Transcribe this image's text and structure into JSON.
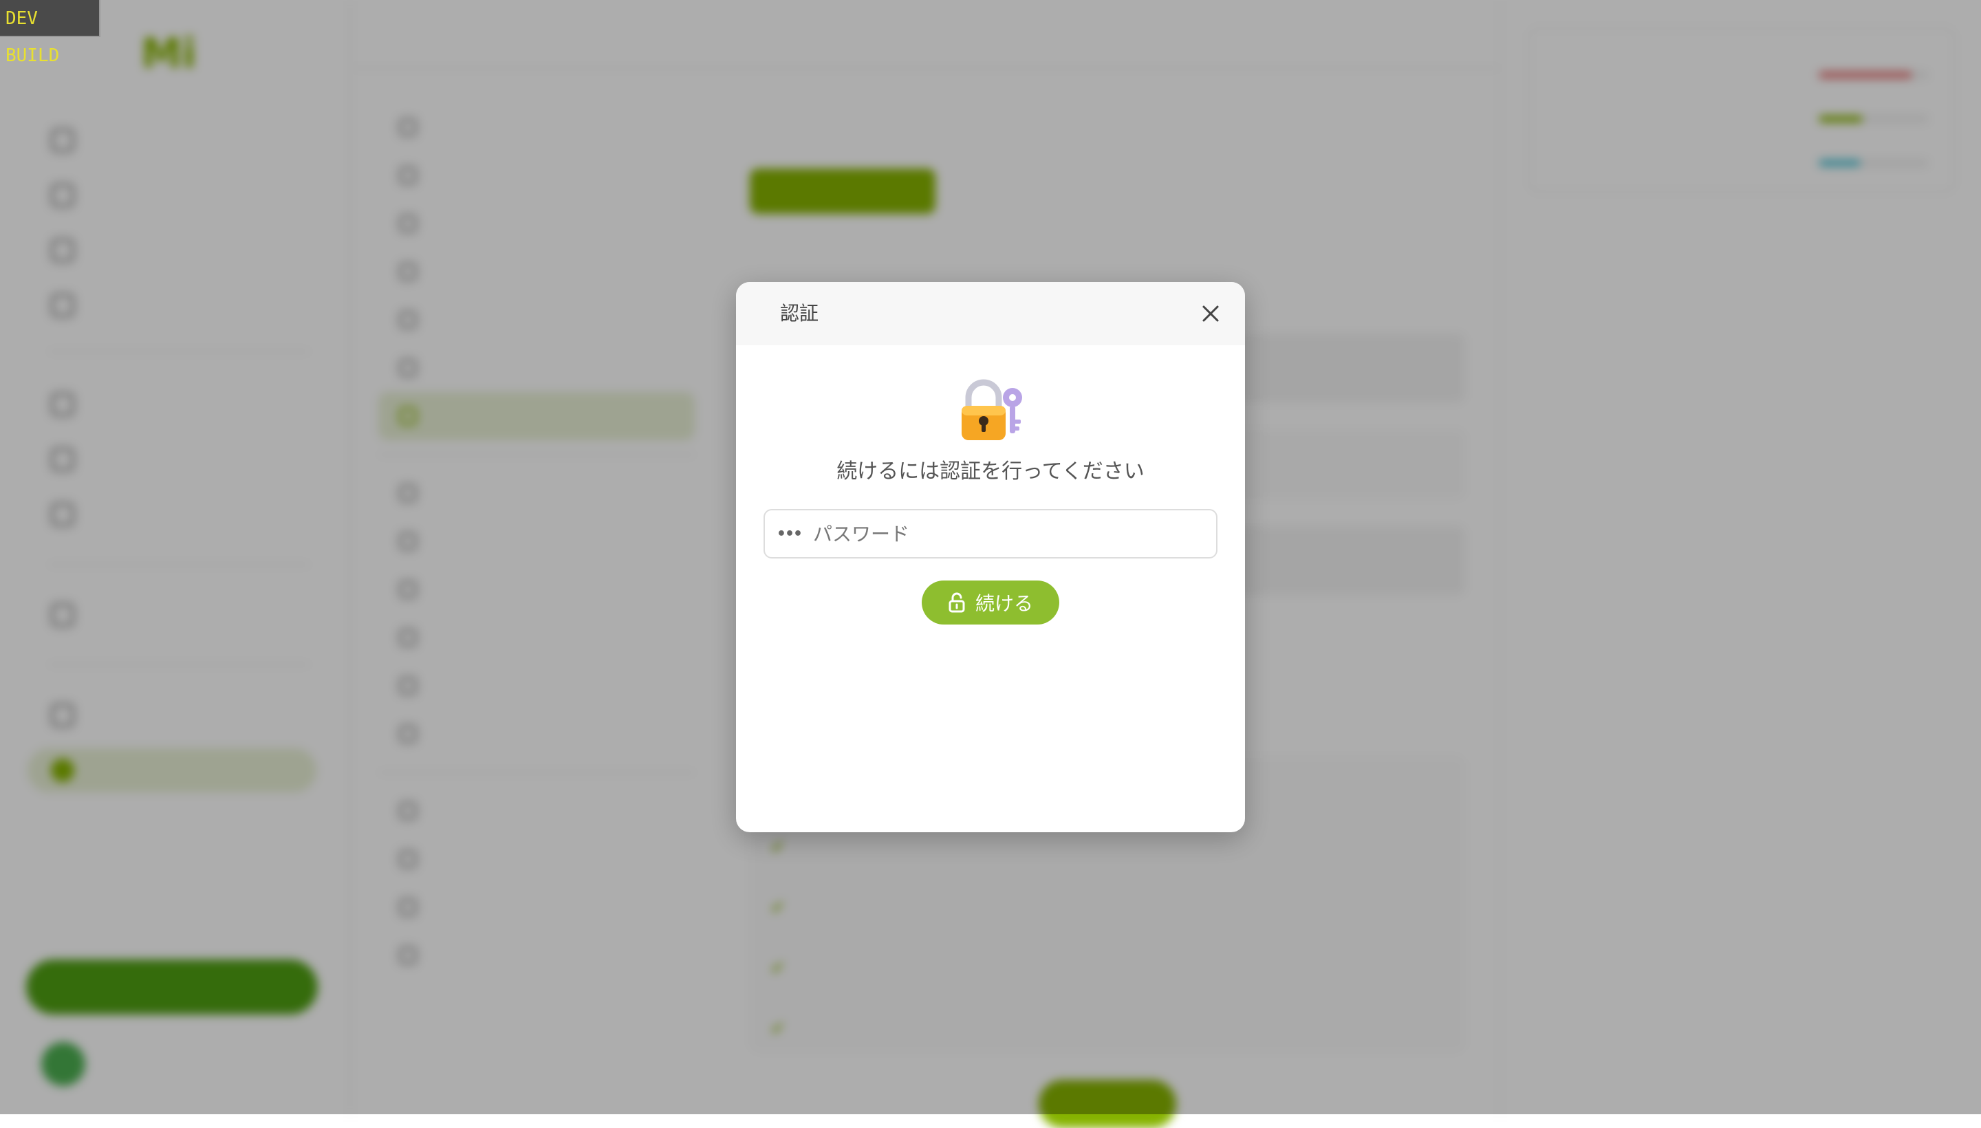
{
  "dev_badge": "DEV BUILD",
  "modal": {
    "title": "認証",
    "prompt": "続けるには認証を行ってください",
    "password_placeholder": "パスワード",
    "password_value": "",
    "password_icon": "•••",
    "continue_label": "続ける",
    "lock_emoji_icon": "locked-with-key-icon",
    "close_icon": "close-icon"
  },
  "colors": {
    "accent": "#86b300",
    "button": "#8ebe2f",
    "overlay": "rgba(0,0,0,0.32)",
    "modal_header": "#f7f7f7"
  }
}
